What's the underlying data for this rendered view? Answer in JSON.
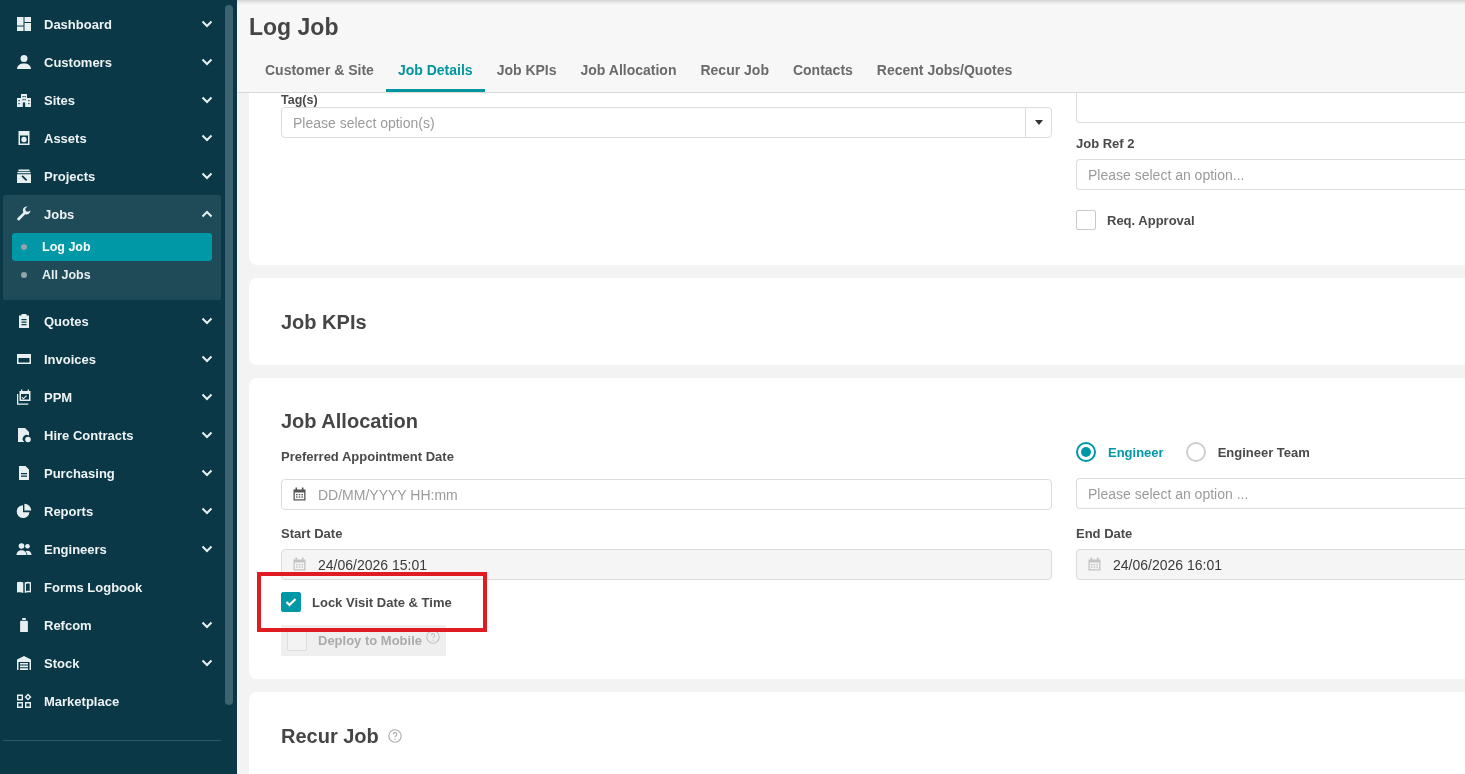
{
  "sidebar": {
    "items": [
      {
        "label": "Dashboard",
        "kind": "group",
        "expanded": false
      },
      {
        "label": "Customers",
        "kind": "group",
        "expanded": false
      },
      {
        "label": "Sites",
        "kind": "group",
        "expanded": false
      },
      {
        "label": "Assets",
        "kind": "group",
        "expanded": false
      },
      {
        "label": "Projects",
        "kind": "group",
        "expanded": false
      },
      {
        "label": "Jobs",
        "kind": "group",
        "expanded": true,
        "children": [
          {
            "label": "Log Job",
            "selected": true
          },
          {
            "label": "All Jobs",
            "selected": false
          }
        ]
      },
      {
        "label": "Quotes",
        "kind": "group",
        "expanded": false
      },
      {
        "label": "Invoices",
        "kind": "group",
        "expanded": false
      },
      {
        "label": "PPM",
        "kind": "group",
        "expanded": false
      },
      {
        "label": "Hire Contracts",
        "kind": "group",
        "expanded": false
      },
      {
        "label": "Purchasing",
        "kind": "group",
        "expanded": false
      },
      {
        "label": "Reports",
        "kind": "group",
        "expanded": false
      },
      {
        "label": "Engineers",
        "kind": "group",
        "expanded": false
      },
      {
        "label": "Forms Logbook",
        "kind": "link"
      },
      {
        "label": "Refcom",
        "kind": "group",
        "expanded": false
      },
      {
        "label": "Stock",
        "kind": "group",
        "expanded": false
      },
      {
        "label": "Marketplace",
        "kind": "link"
      }
    ]
  },
  "header": {
    "title": "Log Job",
    "tabs": [
      {
        "label": "Customer & Site",
        "selected": false
      },
      {
        "label": "Job Details",
        "selected": true
      },
      {
        "label": "Job KPIs",
        "selected": false
      },
      {
        "label": "Job Allocation",
        "selected": false
      },
      {
        "label": "Recur Job",
        "selected": false
      },
      {
        "label": "Contacts",
        "selected": false
      },
      {
        "label": "Recent Jobs/Quotes",
        "selected": false
      }
    ]
  },
  "job_details": {
    "tags": {
      "label": "Tag(s)",
      "placeholder": "Please select option(s)"
    },
    "job_ref_2": {
      "label": "Job Ref 2",
      "placeholder": "Please select an option..."
    },
    "req_approval": {
      "label": "Req. Approval",
      "checked": false
    }
  },
  "job_kpis": {
    "heading": "Job KPIs"
  },
  "job_allocation": {
    "heading": "Job Allocation",
    "preferred_appointment_date": {
      "label": "Preferred Appointment Date",
      "placeholder": "DD/MM/YYYY HH:mm",
      "disabled": false
    },
    "assign_to": [
      {
        "label": "Engineer",
        "selected": true
      },
      {
        "label": "Engineer Team",
        "selected": false
      }
    ],
    "assignee": {
      "placeholder": "Please select an option ..."
    },
    "start_date": {
      "label": "Start Date",
      "value": "24/06/2026 15:01",
      "disabled": true
    },
    "end_date": {
      "label": "End Date",
      "value": "24/06/2026 16:01",
      "disabled": true
    },
    "lock_visit": {
      "label": "Lock Visit Date & Time",
      "checked": true,
      "highlighted": true
    },
    "deploy_to_mobile": {
      "label": "Deploy to Mobile",
      "checked": false,
      "disabled": true
    }
  },
  "recur_job": {
    "heading": "Recur Job"
  }
}
